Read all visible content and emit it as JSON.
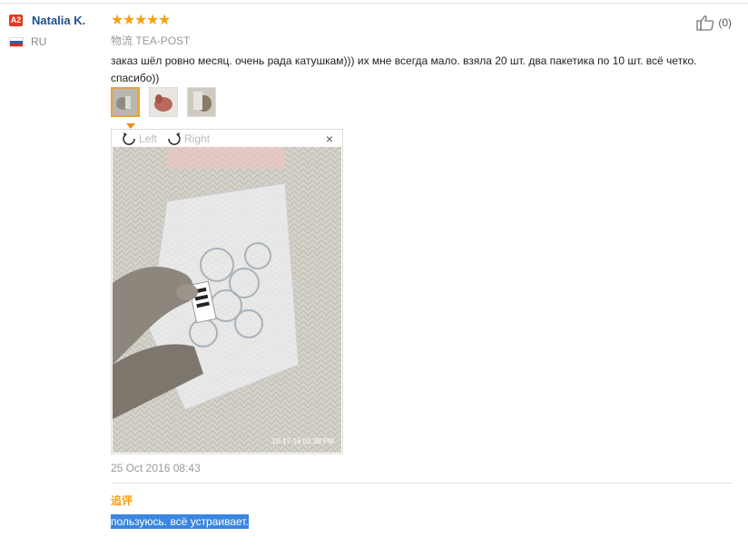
{
  "user": {
    "level": "A2",
    "name": "Natalia K.",
    "country": "RU",
    "flag_colors": [
      "#ffffff",
      "#2b5fb4",
      "#d52b1e"
    ]
  },
  "rating": {
    "stars": 5,
    "max": 5,
    "star_color": "#f7a10e"
  },
  "logistics": {
    "label": "物流",
    "value": "TEA-POST"
  },
  "like": {
    "count_text": "(0)"
  },
  "review": {
    "text": "заказ шёл ровно месяц. очень рада катушкам))) их мне всегда мало. взяла 20 шт. два пакетика по 10 шт. всё четко. спасибо))",
    "date": "25 Oct 2016 08:43"
  },
  "thumbnails": [
    {
      "active": true
    },
    {
      "active": false
    },
    {
      "active": false
    }
  ],
  "viewer": {
    "rotate_left": "Left",
    "rotate_right": "Right",
    "close": "×",
    "photo_stamp": "10-17-16 01:38 PM"
  },
  "additional": {
    "label": "追评",
    "text": "пользуюсь. всё устраивает."
  },
  "colors": {
    "accent": "#f7a10e",
    "name": "#1f4f8f",
    "highlight": "#3a86e0",
    "badge": "#e4391b"
  }
}
